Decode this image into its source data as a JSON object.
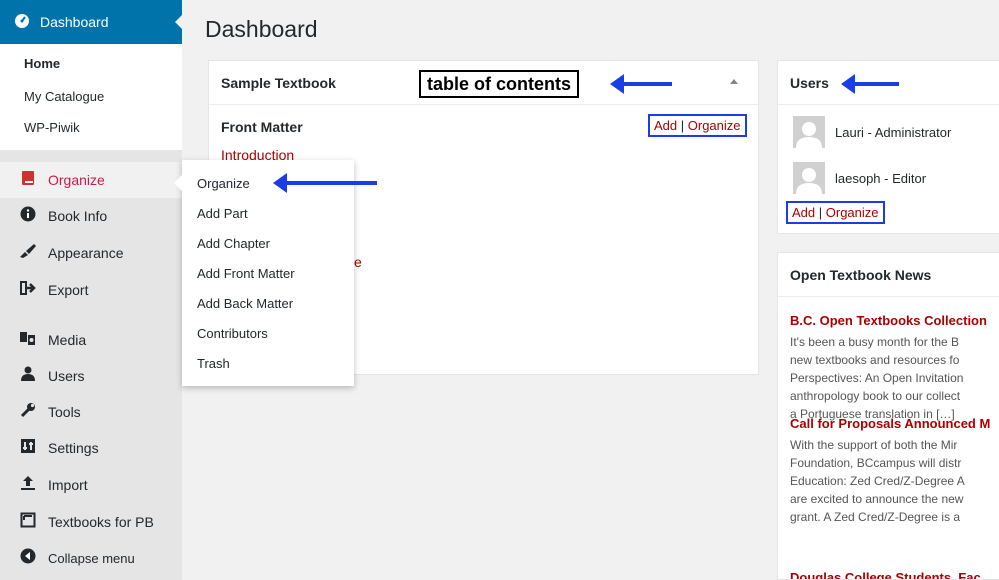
{
  "sidebar": {
    "dashboard_label": "Dashboard",
    "dashboard_sub": [
      "Home",
      "My Catalogue",
      "WP-Piwik"
    ],
    "items": [
      {
        "label": "Organize",
        "icon": "book-icon"
      },
      {
        "label": "Book Info",
        "icon": "info-icon"
      },
      {
        "label": "Appearance",
        "icon": "brush-icon"
      },
      {
        "label": "Export",
        "icon": "export-icon"
      },
      {
        "label": "Media",
        "icon": "media-icon"
      },
      {
        "label": "Users",
        "icon": "users-icon"
      },
      {
        "label": "Tools",
        "icon": "wrench-icon"
      },
      {
        "label": "Settings",
        "icon": "settings-icon"
      },
      {
        "label": "Import",
        "icon": "import-icon"
      },
      {
        "label": "Textbooks for PB",
        "icon": "textbooks-icon"
      },
      {
        "label": "Collapse menu",
        "icon": "collapse-icon"
      }
    ]
  },
  "flyout": {
    "items": [
      "Organize",
      "Add Part",
      "Add Chapter",
      "Add Front Matter",
      "Add Back Matter",
      "Contributors",
      "Trash"
    ]
  },
  "page": {
    "title": "Dashboard"
  },
  "textbook_box": {
    "title": "Sample Textbook",
    "callout": "table of contents",
    "front_matter": "Front Matter",
    "intro_link": "Introduction",
    "partial_text": "e",
    "add": "Add",
    "separator": "|",
    "organize": "Organize"
  },
  "users_box": {
    "title": "Users",
    "users": [
      "Lauri - Administrator",
      "laesoph - Editor"
    ],
    "add": "Add",
    "separator": "|",
    "organize": "Organize"
  },
  "news_box": {
    "title": "Open Textbook News",
    "items": [
      {
        "headline": "B.C. Open Textbooks Collection",
        "lines": [
          "It's been a busy month for the B",
          "new textbooks and resources fo",
          "Perspectives: An Open Invitation",
          "anthropology book to our collect",
          "a Portuguese translation in […]"
        ]
      },
      {
        "headline": "Call for Proposals Announced M",
        "lines": [
          "With the support of both the Mir",
          "Foundation, BCcampus will distr",
          "Education: Zed Cred/Z-Degree A",
          "are excited to announce the new",
          "grant. A Zed Cred/Z-Degree is a"
        ]
      },
      {
        "headline": "Douglas College Students, Fac",
        "lines": []
      }
    ]
  },
  "colors": {
    "sidebar_bg": "#23282d",
    "accent": "#0073aa",
    "link": "#a00",
    "annotation_blue": "#1a3de6"
  }
}
